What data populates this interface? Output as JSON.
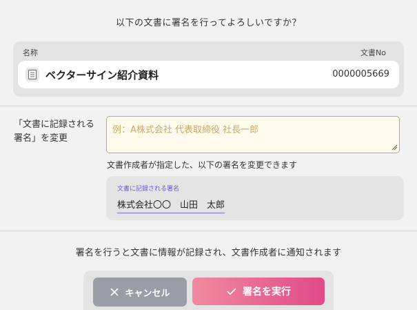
{
  "dialog": {
    "question": "以下の文書に署名を行ってよろしいですか？"
  },
  "document": {
    "header_name": "名称",
    "header_no": "文書No",
    "title": "ベクターサイン紹介資料",
    "number": "0000005669",
    "icon": "document-icon"
  },
  "signature_change": {
    "label": "「文書に記録される署名」を変更",
    "placeholder": "例：A株式会社 代表取締役 社長一郎",
    "value": "",
    "hint": "文書作成者が指定した、以下の署名を変更できます"
  },
  "current_signature": {
    "label": "文書に記録される署名",
    "value": "株式会社〇〇　山田　太郎"
  },
  "notice": "署名を行うと文書に情報が記録され、文書作成者に通知されます",
  "buttons": {
    "cancel_label": "キャンセル",
    "cancel_icon": "close-icon",
    "execute_label": "署名を実行",
    "execute_icon": "checkmark-icon"
  },
  "colors": {
    "background": "#f2f2f2",
    "card": "#e3e3e3",
    "input_bg": "#fffbec",
    "placeholder": "#c8a86a",
    "accent_purple": "#6a5acd",
    "cancel_button": "#9a9ca6",
    "execute_gradient_start": "#f08aa0",
    "execute_gradient_end": "#e04a88"
  }
}
